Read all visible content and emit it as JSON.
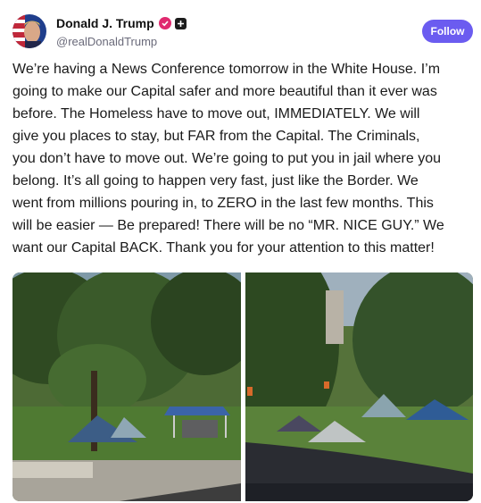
{
  "post": {
    "author": {
      "display_name": "Donald J. Trump",
      "handle": "@realDonaldTrump",
      "avatar_icon": "avatar-photo",
      "verified_icon": "verified-badge-icon",
      "affiliation_icon": "affiliation-plus-icon"
    },
    "follow_label": "Follow",
    "text": "We’re having a News Conference tomorrow in the White House. I’m\ngoing to make our Capital safer and more beautiful than it ever was\nbefore. The Homeless have to move out, IMMEDIATELY. We will\ngive you places to stay, but FAR from the Capital. The Criminals,\nyou don’t have to move out. We’re going to put you in jail where you\nbelong. It’s all going to happen very fast, just like the Border. We\nwent from millions pouring in, to ZERO in the last few months. This\nwill be easier — Be prepared! There will be no “MR. NICE GUY.” We\nwant our Capital BACK. Thank you for your attention to this matter!",
    "media": [
      {
        "name": "photo-tents-park-left"
      },
      {
        "name": "photo-tents-park-right"
      }
    ]
  },
  "colors": {
    "accent": "#6b5cf0",
    "verified": "#e0296f",
    "handle": "#6a6a7a"
  }
}
